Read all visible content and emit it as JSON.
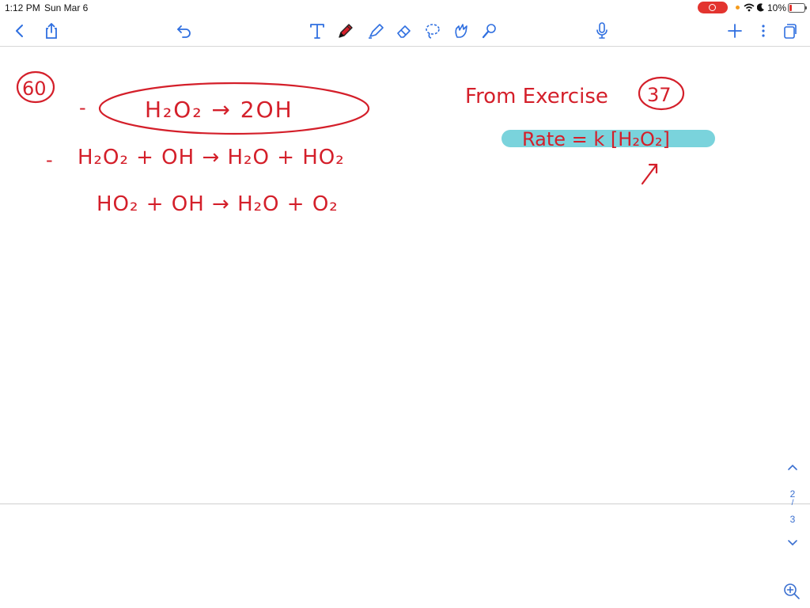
{
  "status_bar": {
    "time": "1:12 PM",
    "date": "Sun Mar 6",
    "battery": "10%",
    "battery_level": 0.1
  },
  "toolbar": {
    "left_icons": [
      "chevron-left-icon",
      "share-icon"
    ],
    "center_icons": [
      "undo-icon",
      "text-tool-icon",
      "pen-icon",
      "highlighter-icon",
      "eraser-icon",
      "lasso-icon",
      "shapes-icon",
      "laser-pointer-icon"
    ],
    "right_icons": [
      "microphone-icon",
      "add-page-icon",
      "more-icon",
      "pages-icon"
    ],
    "accent_color": "#2f6fe0",
    "pen_color": "#d41f2a"
  },
  "notes": {
    "problem_number": "60",
    "step1": "H₂O₂ → 2OH",
    "step2": "H₂O₂ + OH → H₂O + HO₂",
    "step3": "HO₂ + OH → H₂O + O₂",
    "from_exercise": "From Exercise",
    "exercise_number": "37",
    "rate_law": "Rate = k [H₂O₂]",
    "ink_color": "#d41f2a",
    "highlight_color": "#7ad3dc"
  },
  "pager": {
    "current": "2",
    "total": "3"
  }
}
